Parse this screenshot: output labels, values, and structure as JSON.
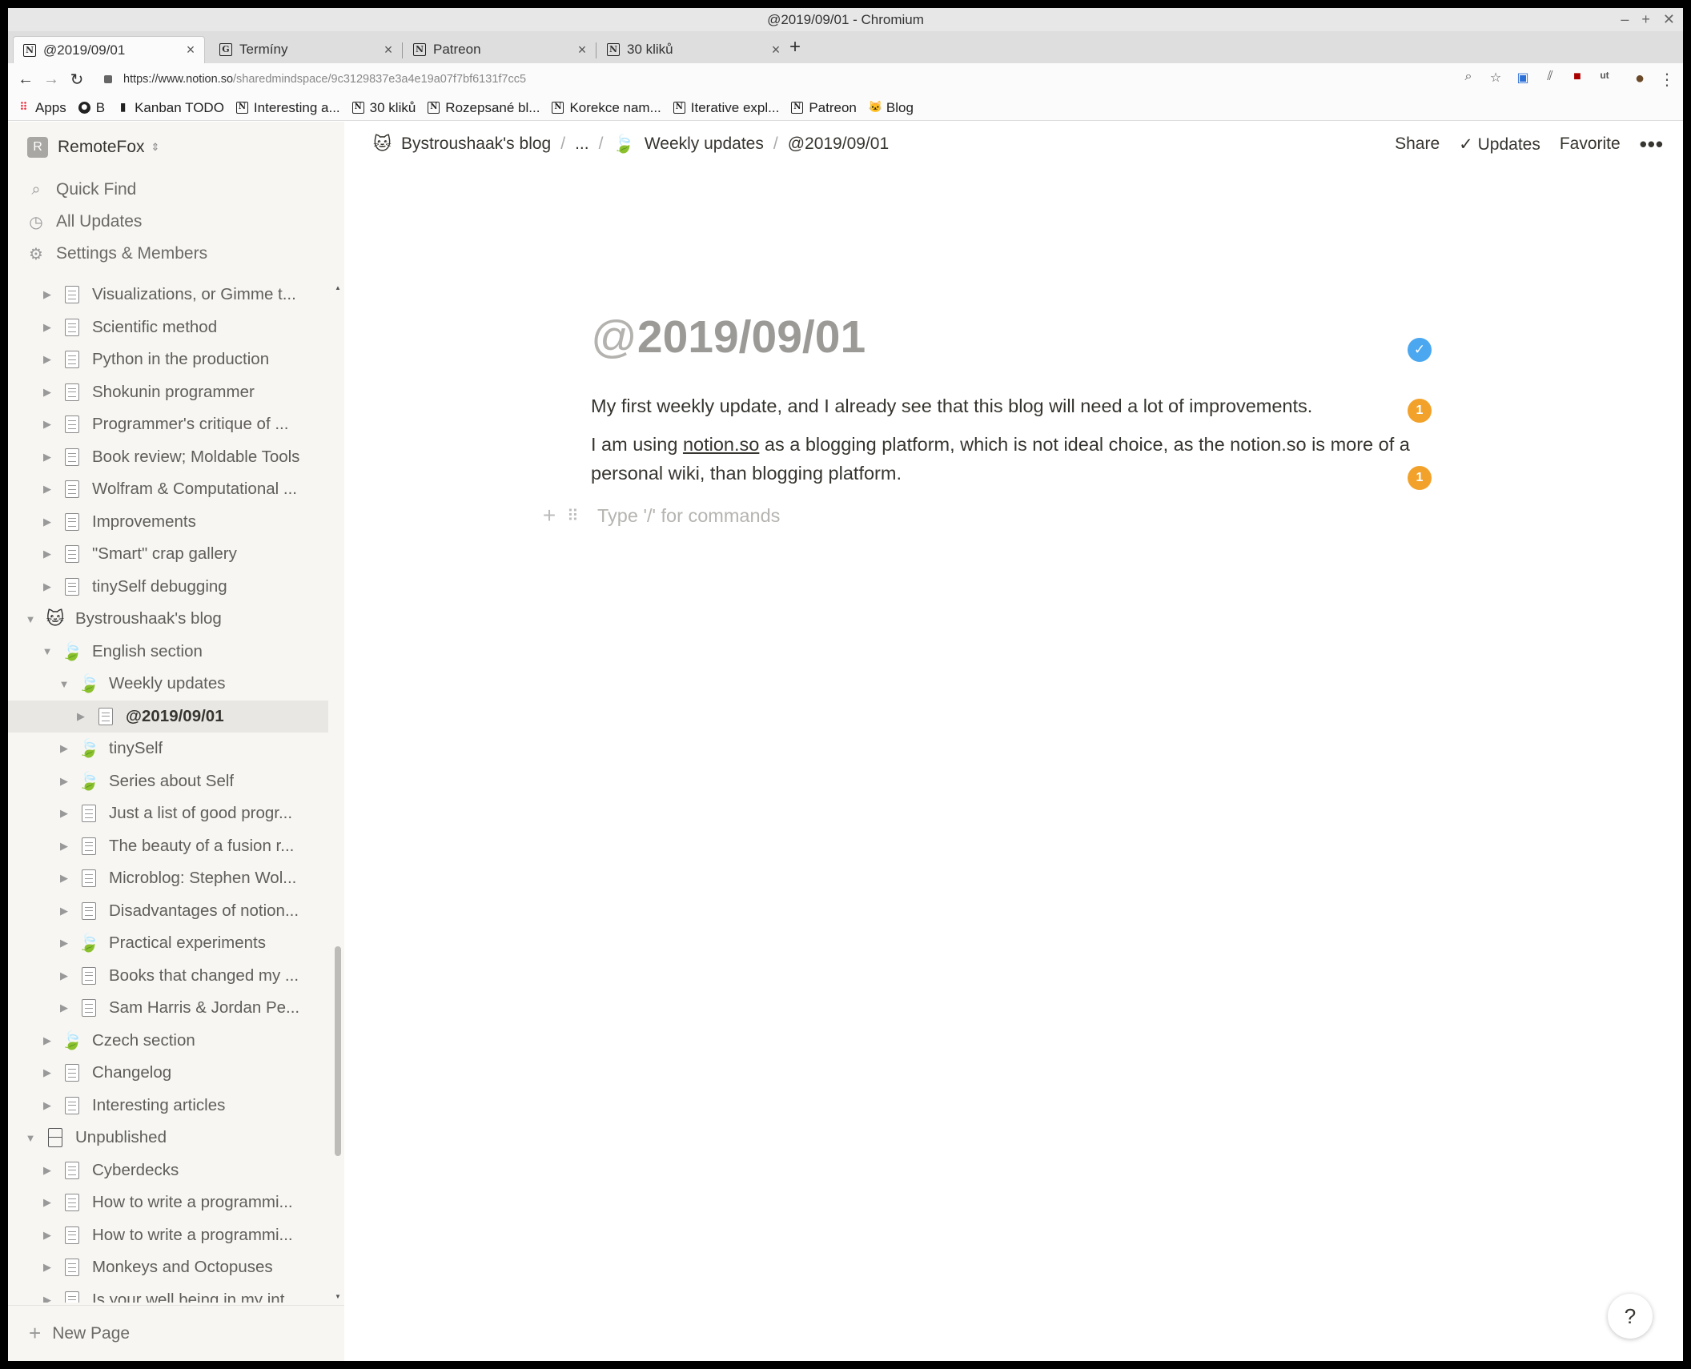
{
  "window": {
    "title": "@2019/09/01 - Chromium"
  },
  "tabs": [
    {
      "label": "@2019/09/01",
      "favicon": "N"
    },
    {
      "label": "Termíny",
      "favicon": "G"
    },
    {
      "label": "Patreon",
      "favicon": "N"
    },
    {
      "label": "30 kliků",
      "favicon": "N"
    }
  ],
  "toolbar": {
    "url_host": "https://www.notion.so",
    "url_path": "/sharedmindspace/9c3129837e3a4e19a07f7bf6131f7cc5"
  },
  "bookmarks": [
    {
      "label": "Apps",
      "icon": "apps-grid-icon"
    },
    {
      "label": "B",
      "icon": "github-icon"
    },
    {
      "label": "Kanban TODO",
      "icon": "document-icon"
    },
    {
      "label": "Interesting a...",
      "icon": "notion-icon"
    },
    {
      "label": "30 kliků",
      "icon": "notion-icon"
    },
    {
      "label": "Rozepsané bl...",
      "icon": "notion-icon"
    },
    {
      "label": "Korekce nam...",
      "icon": "notion-icon"
    },
    {
      "label": "Iterative expl...",
      "icon": "notion-icon"
    },
    {
      "label": "Patreon",
      "icon": "notion-icon"
    },
    {
      "label": "Blog",
      "icon": "fox-icon"
    }
  ],
  "sidebar": {
    "workspace_initial": "R",
    "workspace_name": "RemoteFox",
    "nav": {
      "quick_find": "Quick Find",
      "all_updates": "All Updates",
      "settings": "Settings & Members"
    },
    "tree": [
      {
        "label": "Visualizations, or Gimme t...",
        "icon": "page",
        "depth": 1,
        "expanded": false
      },
      {
        "label": "Scientific method",
        "icon": "page",
        "depth": 1,
        "expanded": false
      },
      {
        "label": "Python in the production",
        "icon": "page",
        "depth": 1,
        "expanded": false
      },
      {
        "label": "Shokunin programmer",
        "icon": "page",
        "depth": 1,
        "expanded": false
      },
      {
        "label": "Programmer's critique of ...",
        "icon": "page",
        "depth": 1,
        "expanded": false
      },
      {
        "label": "Book review; Moldable Tools",
        "icon": "page",
        "depth": 1,
        "expanded": false
      },
      {
        "label": "Wolfram & Computational ...",
        "icon": "page",
        "depth": 1,
        "expanded": false
      },
      {
        "label": "Improvements",
        "icon": "page",
        "depth": 1,
        "expanded": false
      },
      {
        "label": "\"Smart\" crap gallery",
        "icon": "page",
        "depth": 1,
        "expanded": false
      },
      {
        "label": "tinySelf debugging",
        "icon": "page",
        "depth": 1,
        "expanded": false
      },
      {
        "label": "Bystroushaak's blog",
        "icon": "fox",
        "depth": 0,
        "expanded": true
      },
      {
        "label": "English section",
        "icon": "leaf",
        "depth": 1,
        "expanded": true
      },
      {
        "label": "Weekly updates",
        "icon": "leaf",
        "depth": 2,
        "expanded": true
      },
      {
        "label": "@2019/09/01",
        "icon": "page",
        "depth": 3,
        "expanded": false,
        "selected": true
      },
      {
        "label": "tinySelf",
        "icon": "leaf",
        "depth": 2,
        "expanded": false
      },
      {
        "label": "Series about Self",
        "icon": "leaf",
        "depth": 2,
        "expanded": false
      },
      {
        "label": "Just a list of good progr...",
        "icon": "page",
        "depth": 2,
        "expanded": false
      },
      {
        "label": "The beauty of a fusion r...",
        "icon": "page",
        "depth": 2,
        "expanded": false
      },
      {
        "label": "Microblog: Stephen Wol...",
        "icon": "page",
        "depth": 2,
        "expanded": false
      },
      {
        "label": "Disadvantages of notion...",
        "icon": "page",
        "depth": 2,
        "expanded": false
      },
      {
        "label": "Practical experiments",
        "icon": "leaf",
        "depth": 2,
        "expanded": false
      },
      {
        "label": "Books that changed my ...",
        "icon": "page",
        "depth": 2,
        "expanded": false
      },
      {
        "label": "Sam Harris & Jordan Pe...",
        "icon": "page",
        "depth": 2,
        "expanded": false
      },
      {
        "label": "Czech section",
        "icon": "leaf",
        "depth": 1,
        "expanded": false
      },
      {
        "label": "Changelog",
        "icon": "page",
        "depth": 1,
        "expanded": false
      },
      {
        "label": "Interesting articles",
        "icon": "page",
        "depth": 1,
        "expanded": false
      },
      {
        "label": "Unpublished",
        "icon": "cabinet",
        "depth": 0,
        "expanded": true
      },
      {
        "label": "Cyberdecks",
        "icon": "page",
        "depth": 1,
        "expanded": false
      },
      {
        "label": "How to write a programmi...",
        "icon": "page",
        "depth": 1,
        "expanded": false
      },
      {
        "label": "How to write a programmi...",
        "icon": "page",
        "depth": 1,
        "expanded": false
      },
      {
        "label": "Monkeys and Octopuses",
        "icon": "page",
        "depth": 1,
        "expanded": false
      },
      {
        "label": "Is your well being in my int...",
        "icon": "page",
        "depth": 1,
        "expanded": false
      }
    ],
    "new_page": "New Page"
  },
  "topbar": {
    "crumbs": {
      "blog": "Bystroushaak's blog",
      "ellipsis": "...",
      "weekly": "Weekly updates",
      "current": "@2019/09/01"
    },
    "share": "Share",
    "updates": "Updates",
    "favorite": "Favorite"
  },
  "page": {
    "title_at": "@",
    "title_rest": "2019/09/01",
    "paragraph1": "My first weekly update, and I already see that this blog will need a lot of improvements.",
    "paragraph2_before": "I am using ",
    "paragraph2_link": "notion.so",
    "paragraph2_after_line1": " as a blogging platform, which is not ideal choice, as the notion.so is more of a",
    "paragraph2_line2": "personal wiki, than blogging platform.",
    "command_placeholder": "Type '/' for commands",
    "comment_count_1": "1",
    "comment_count_2": "1"
  },
  "help": "?",
  "colors": {
    "badge_blue": "#4aa7f0",
    "badge_orange": "#f2a22b",
    "sidebar_bg": "#f7f6f3",
    "text": "#37352f"
  }
}
